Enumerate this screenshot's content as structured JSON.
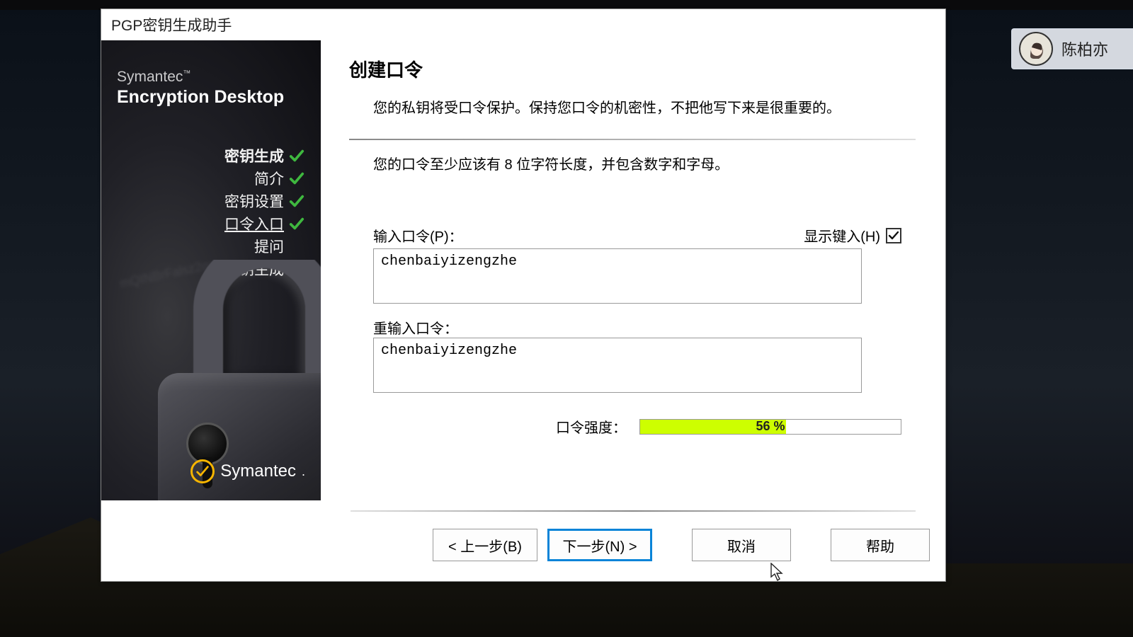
{
  "window": {
    "title": "PGP密钥生成助手"
  },
  "sidebar": {
    "brand1": "Symantec",
    "brand_tm": "™",
    "brand2": "Encryption Desktop",
    "steps": [
      {
        "label": "密钥生成",
        "done": true,
        "current": false
      },
      {
        "label": "简介",
        "done": true,
        "current": false
      },
      {
        "label": "密钥设置",
        "done": true,
        "current": false
      },
      {
        "label": "口令入口",
        "done": true,
        "current": true
      },
      {
        "label": "提问",
        "done": false,
        "current": false
      },
      {
        "label": "密钥生成",
        "done": false,
        "current": false
      }
    ],
    "symantec_label": "Symantec"
  },
  "content": {
    "heading": "创建口令",
    "desc1": "您的私钥将受口令保护。保持您口令的机密性，不把他写下来是很重要的。",
    "desc2": "您的口令至少应该有 8 位字符长度，并包含数字和字母。",
    "pass_label": "输入口令(P)：",
    "show_typing_label": "显示键入(H)",
    "show_typing_checked": true,
    "pass_value": "chenbaiyizengzhe",
    "confirm_label": "重输入口令：",
    "confirm_value": "chenbaiyizengzhe",
    "strength_label": "口令强度：",
    "strength_pct_text": "56 %",
    "strength_pct_value": 56
  },
  "buttons": {
    "back": "< 上一步(B)",
    "next": "下一步(N) >",
    "cancel": "取消",
    "help": "帮助"
  },
  "overlay": {
    "user_name": "陈柏亦"
  }
}
